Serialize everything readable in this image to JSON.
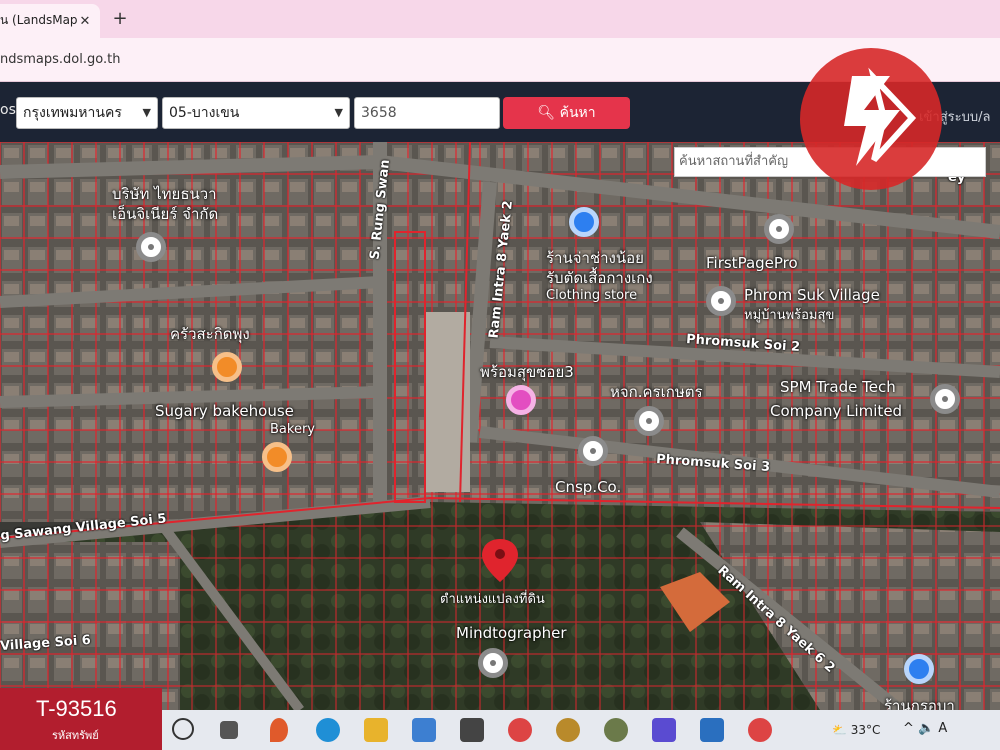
{
  "browser": {
    "tab_title": "น (LandsMap",
    "tab_close": "✕",
    "new_tab": "+",
    "url": "ndsmaps.dol.go.th"
  },
  "toolbar": {
    "left_edge": "os",
    "province": "กรุงเทพมหานคร",
    "district": "05-บางเขน",
    "parcel_number": "3658",
    "search_label": "ค้นหา",
    "login_label": "เข้าสู่ระบบ/ล"
  },
  "map": {
    "place_search_placeholder": "ค้นหาสถานที่สำคัญ",
    "roads": {
      "rung_swang": "S. Rung Swan",
      "ram_intra_8_yaek2": "Ram Intra 8 Yaek 2",
      "phromsuk_soi2": "Phromsuk Soi 2",
      "phromsuk_soi3": "Phromsuk Soi 3",
      "sawang_village_soi5": "g Sawang Village Soi 5",
      "village_soi6": "Village Soi 6",
      "ram_intra_8_yaek6": "Ram Intra 8 Yaek 6 2",
      "top_right_road": "ey"
    },
    "places": {
      "company_th_1": "บริษัท ไทยธนวา",
      "company_th_2": "เอ็นจิเนียร์ จำกัด",
      "shop_th_1": "ร้านจ่าช่างน้อย",
      "shop_th_2": "รับตัดเสื้อกางเกง",
      "clothing": "Clothing store",
      "firstpage": "FirstPagePro",
      "phrom_suk_village": "Phrom Suk Village",
      "phrom_suk_village_th": "หมู่บ้านพร้อมสุข",
      "krua": "ครัวสะกิดพุง",
      "phrom_suk_soi3_th": "พร้อมสุขซอย3",
      "hok_kaset": "หจก.ครเกษตร",
      "spm_1": "SPM Trade Tech",
      "spm_2": "Company Limited",
      "sugary": "Sugary bakehouse",
      "bakery": "Bakery",
      "cnsp": "Cnsp.Co.",
      "parcel_location": "ตำแหน่งแปลงที่ดิน",
      "mindtographer": "Mindtographer",
      "bottom_right_th": "ร้านกรอบา"
    }
  },
  "watermark": {
    "code": "T-93516",
    "subtitle": "รหัสทรัพย์"
  },
  "taskbar": {
    "temperature": "33°C",
    "tray": "^ 🔈 A"
  },
  "colors": {
    "parcel_line": "#e0242d",
    "search_button": "#e5344b",
    "logo_red": "#d62828",
    "toolbar_bg": "#1c2434",
    "tab_bg": "#f7d7e9"
  }
}
